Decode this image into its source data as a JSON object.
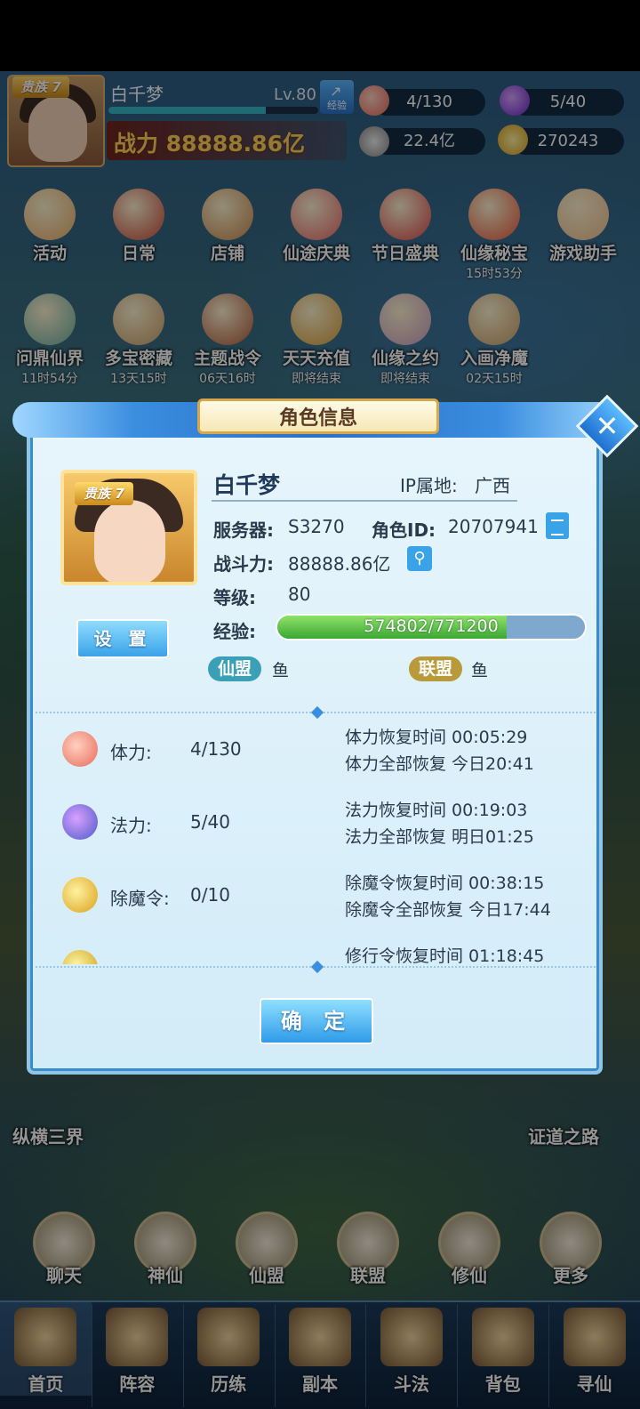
{
  "header": {
    "noble_tag": "贵族 7",
    "player_name": "白千梦",
    "level": "Lv.80",
    "exp_button": "经验",
    "exp_progress": 0.75,
    "power": "战力 88888.86亿",
    "stamina": "4/130",
    "mana": "5/40",
    "coins": "22.4亿",
    "gold": "270243"
  },
  "activities": [
    {
      "label": "活动",
      "sub": ""
    },
    {
      "label": "日常",
      "sub": ""
    },
    {
      "label": "店铺",
      "sub": ""
    },
    {
      "label": "仙途庆典",
      "sub": ""
    },
    {
      "label": "节日盛典",
      "sub": ""
    },
    {
      "label": "仙缘秘宝",
      "sub": "15时53分"
    },
    {
      "label": "游戏助手",
      "sub": ""
    },
    {
      "label": "问鼎仙界",
      "sub": "11时54分"
    },
    {
      "label": "多宝密藏",
      "sub": "13天15时"
    },
    {
      "label": "主题战令",
      "sub": "06天16时"
    },
    {
      "label": "天天充值",
      "sub": "即将结束"
    },
    {
      "label": "仙缘之约",
      "sub": "即将结束"
    },
    {
      "label": "入画净魔",
      "sub": "02天15时"
    }
  ],
  "dialog": {
    "title": "角色信息",
    "noble_tag": "贵族 7",
    "settings_button": "设 置",
    "name": "白千梦",
    "ip_label": "IP属地:",
    "ip_value": "广西",
    "server_label": "服务器:",
    "server_value": "S3270",
    "role_id_label": "角色ID:",
    "role_id_value": "20707941",
    "power_label": "战斗力:",
    "power_value": "88888.86亿",
    "level_label": "等级:",
    "level_value": "80",
    "exp_label": "经验:",
    "exp_value": "574802/771200",
    "exp_progress": 0.745,
    "xianmeng_tag": "仙盟",
    "xianmeng_value": "鱼",
    "lianmeng_tag": "联盟",
    "lianmeng_value": "鱼",
    "stats": [
      {
        "icon": "peach-icon",
        "label": "体力:",
        "value": "4/130",
        "line1": "体力恢复时间 00:05:29",
        "line2": "体力全部恢复 今日20:41"
      },
      {
        "icon": "mana-flame-icon",
        "label": "法力:",
        "value": "5/40",
        "line1": "法力恢复时间 00:19:03",
        "line2": "法力全部恢复 明日01:25"
      },
      {
        "icon": "demon-token-icon",
        "label": "除魔令:",
        "value": "0/10",
        "line1": "除魔令恢复时间 00:38:15",
        "line2": "除魔令全部恢复 今日17:44"
      },
      {
        "icon": "cultivation-token-icon",
        "label": "",
        "value": "",
        "line1": "修行令恢复时间 01:18:45",
        "line2": ""
      }
    ],
    "ok_button": "确 定"
  },
  "side": {
    "left_label": "纵横三界",
    "right_label": "证道之路"
  },
  "nav_row": [
    "聊天",
    "神仙",
    "仙盟",
    "联盟",
    "修仙",
    "更多"
  ],
  "tabs": [
    "首页",
    "阵容",
    "历练",
    "副本",
    "斗法",
    "背包",
    "寻仙"
  ],
  "colors": {
    "dialog_bg": "#e7f5fc",
    "exp_fill": "#3aa632",
    "power_text": "#ffd25a",
    "tag_xianmeng": "#3aa0b8",
    "tag_lianmeng": "#b89a3a"
  }
}
